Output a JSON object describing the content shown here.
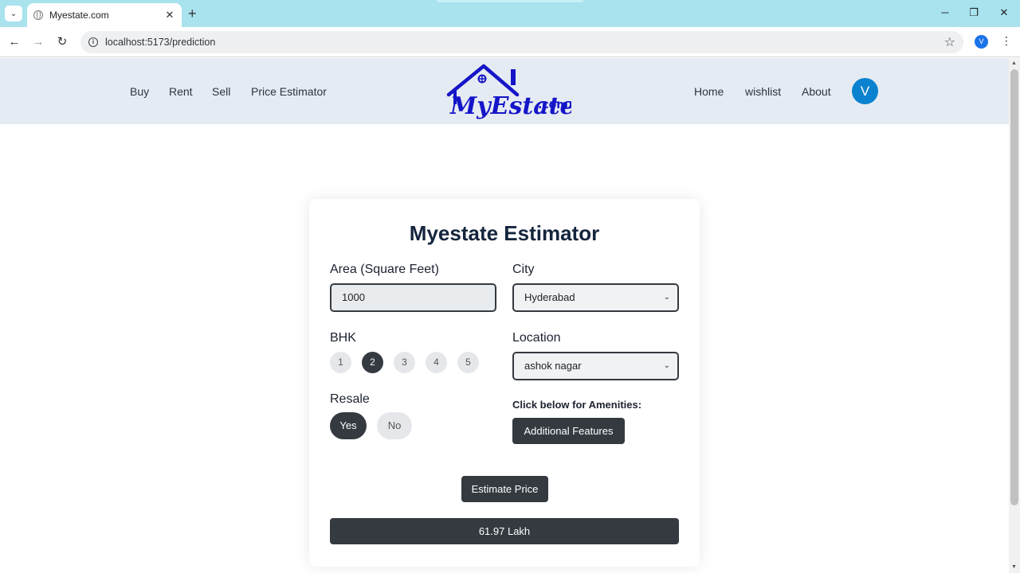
{
  "browser": {
    "tab_title": "Myestate.com",
    "url": "localhost:5173/prediction",
    "profile_initial": "V"
  },
  "header": {
    "nav_left": [
      "Buy",
      "Rent",
      "Sell",
      "Price Estimator"
    ],
    "logo_text": "MyEstate.com",
    "nav_right": [
      "Home",
      "wishlist",
      "About"
    ],
    "avatar_initial": "V",
    "accent_color": "#0a82d0",
    "logo_color": "#1515c8"
  },
  "form": {
    "title": "Myestate Estimator",
    "area_label": "Area (Square Feet)",
    "area_value": "1000",
    "city_label": "City",
    "city_value": "Hyderabad",
    "bhk_label": "BHK",
    "bhk_options": [
      "1",
      "2",
      "3",
      "4",
      "5"
    ],
    "bhk_selected": "2",
    "location_label": "Location",
    "location_value": "ashok nagar",
    "resale_label": "Resale",
    "resale_yes": "Yes",
    "resale_no": "No",
    "resale_selected": "Yes",
    "amenities_label": "Click below for Amenities:",
    "amenities_button": "Additional Features",
    "estimate_button": "Estimate Price",
    "result": "61.97 Lakh",
    "button_color": "#343a40"
  }
}
